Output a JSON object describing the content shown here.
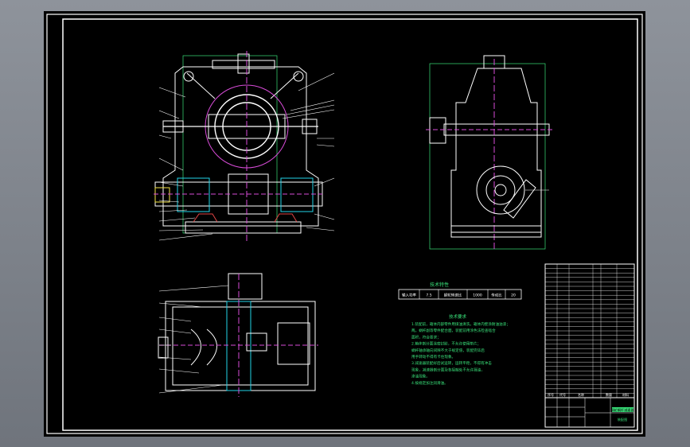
{
  "viewer": {
    "background": "#000000",
    "frame_color": "#ffffff",
    "window_bg": "#7d8289"
  },
  "colors": {
    "outline": "#ffffff",
    "green": "#39e27a",
    "magenta": "#d94cd9",
    "cyan": "#22d3e8",
    "yellow": "#f4e54a",
    "red": "#e24545"
  },
  "drawing": {
    "params_title": "技术特性",
    "params_row": [
      "输入功率",
      "7.5",
      "蜗轮转速比",
      "1000",
      "传动比",
      "20"
    ],
    "requirements_title": "技术要求",
    "requirements": [
      "1.装配前，箱体内部零件用煤油清洗，箱体内壁涂耐油油漆；",
      "两。蜗杆副等零件配合面，装配前用涂色法检查啮合",
      "面积，符合要求；",
      "2.箱体剖分面涂密封胶，不允许使用垫片；",
      "蜗杆轴承轴向间隙不大于规定值，装配完毕后",
      "用手转动不得有卡住现象。",
      "3.减速器装配好后试运转，运转平稳，不得有冲击",
      "现象，减速器剖分面及各接触处不允许漏油，",
      "渗油现象。",
      "4.按规定加注润滑油。"
    ],
    "bom_footer": [
      "序号",
      "代号",
      "名称",
      "数量",
      "材料"
    ],
    "title_block": {
      "drawing_name": "蜗轮蜗杆减速器",
      "drawing_no": "装配图"
    }
  }
}
